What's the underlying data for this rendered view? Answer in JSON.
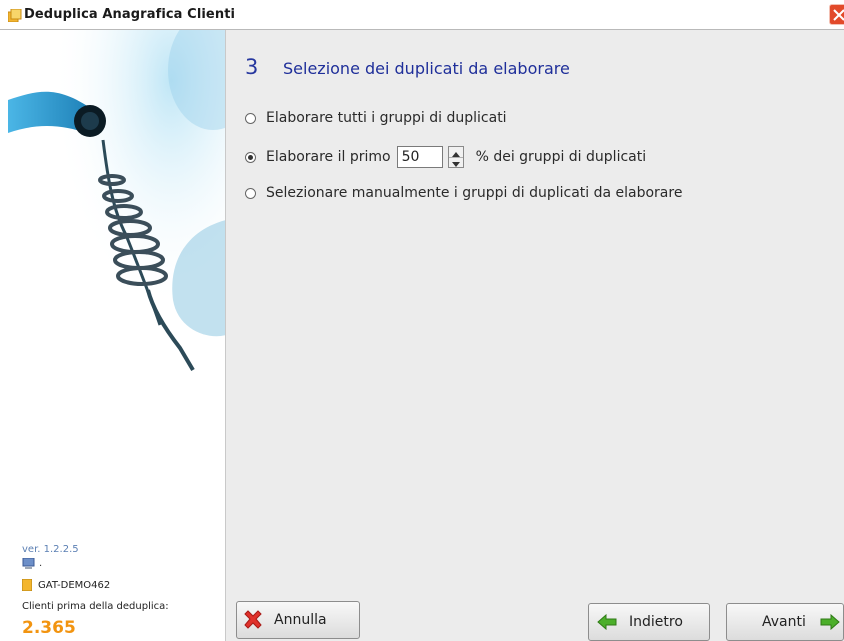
{
  "window": {
    "title": "Deduplica Anagrafica Clienti",
    "app_icon": "folder-app-icon",
    "close_icon": "close-x-icon"
  },
  "sidebar": {
    "artwork": "telephone-cord-artwork",
    "version": "ver. 1.2.2.5",
    "computer_icon": "computer-icon",
    "computer_name": ".",
    "database_icon": "database-icon",
    "database_name": "GAT-DEMO462",
    "count_label": "Clienti prima della deduplica:",
    "count_value": "2.365"
  },
  "step": {
    "number": "3",
    "title": "Selezione dei duplicati da elaborare"
  },
  "options": [
    {
      "label": "Elaborare tutti i gruppi di duplicati",
      "selected": false
    },
    {
      "label": "Elaborare il primo",
      "selected": true,
      "value": "50",
      "suffix": "%  dei gruppi di duplicati"
    },
    {
      "label": "Selezionare manualmente i gruppi di duplicati da elaborare",
      "selected": false
    }
  ],
  "buttons": {
    "cancel": {
      "label": "Annulla",
      "icon": "red-x-icon"
    },
    "back": {
      "label": "Indietro",
      "icon": "green-arrow-left-icon"
    },
    "next": {
      "label": "Avanti",
      "icon": "green-arrow-right-icon"
    }
  },
  "colors": {
    "accent_title": "#1f2f9a",
    "count_value": "#f29410",
    "panel_bg": "#ececec"
  }
}
